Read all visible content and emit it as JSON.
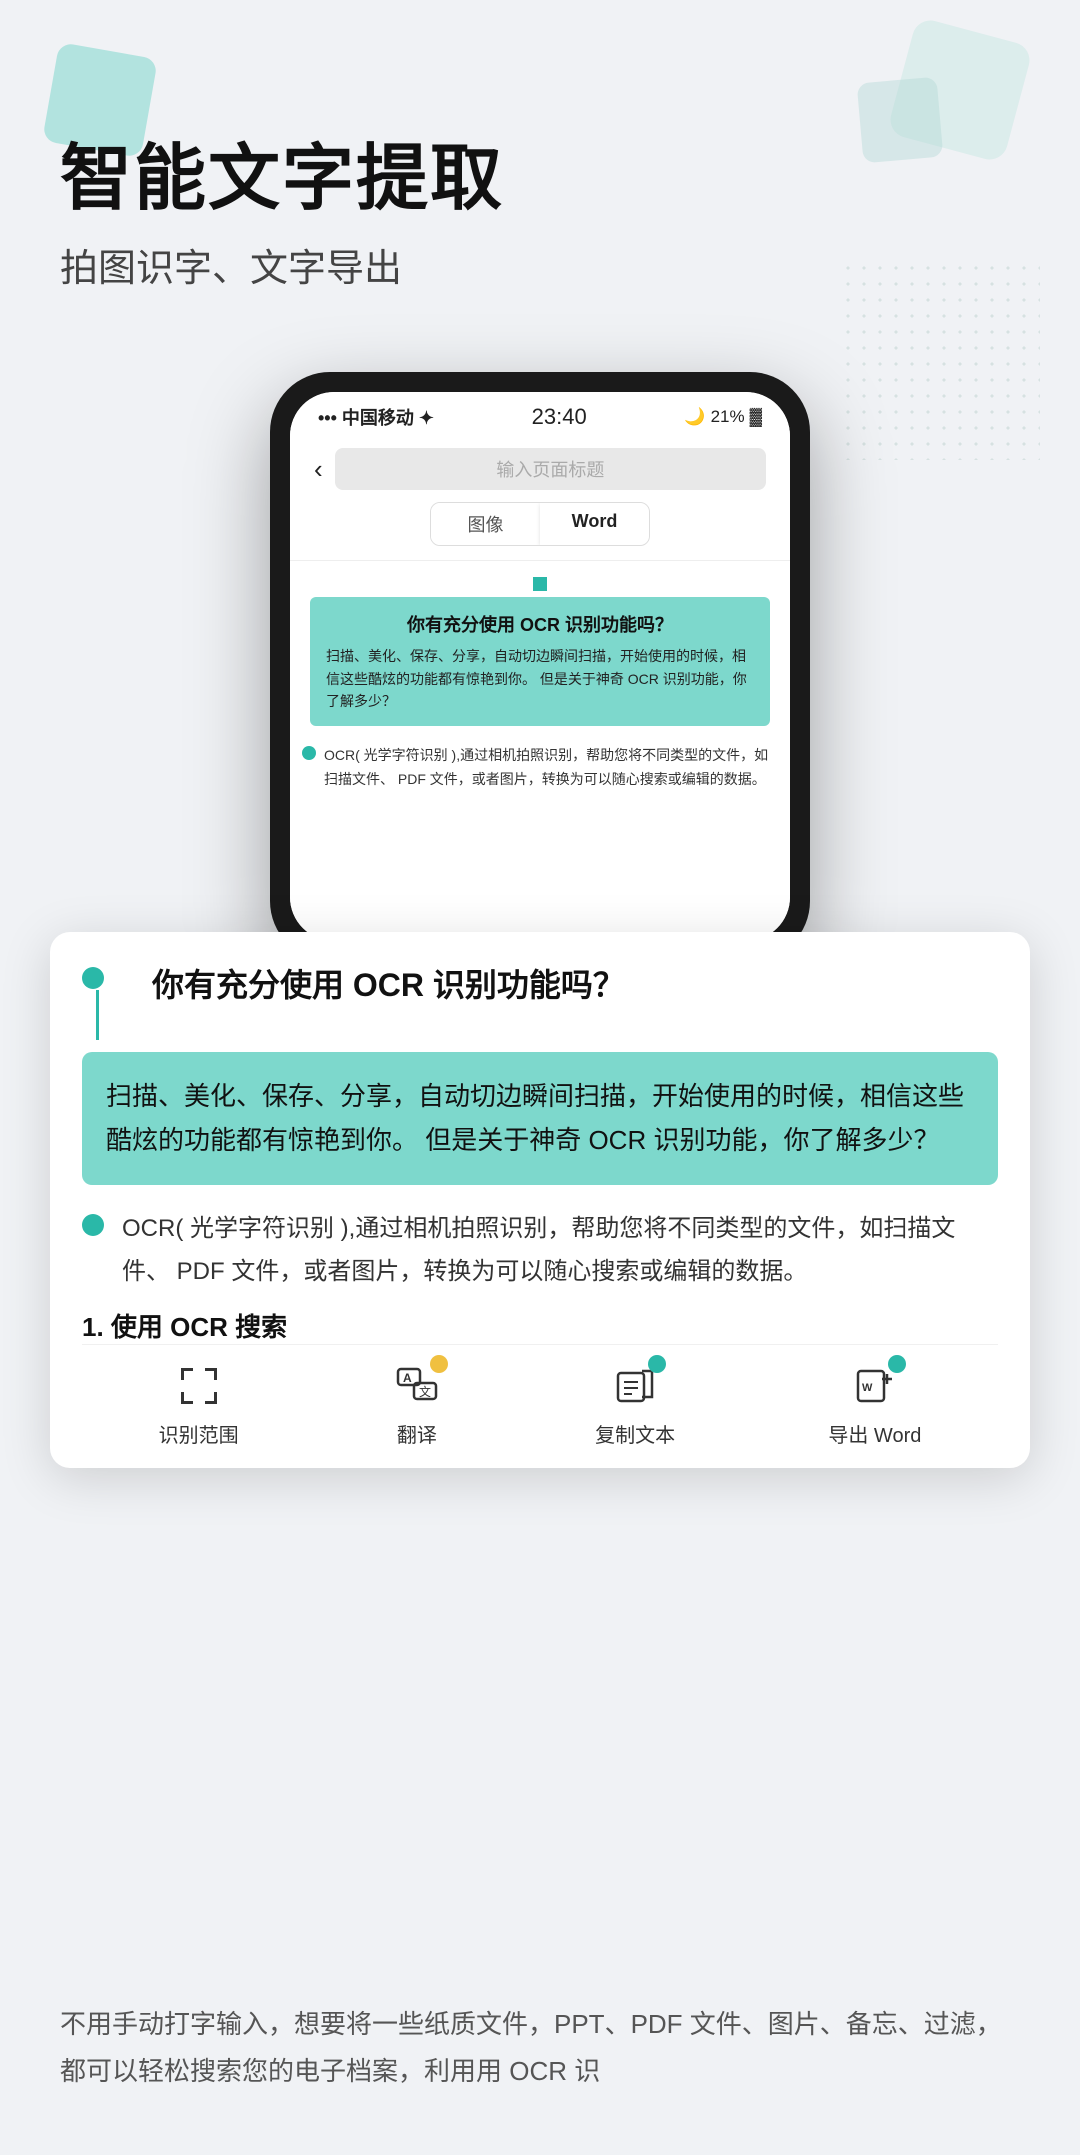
{
  "hero": {
    "title": "智能文字提取",
    "subtitle": "拍图识字、文字导出"
  },
  "phone": {
    "status": {
      "carrier": "中国移动 ✦",
      "time": "23:40",
      "battery": "21%"
    },
    "header": {
      "back": "‹",
      "title_placeholder": "输入页面标题",
      "tab_image": "图像",
      "tab_word": "Word"
    },
    "ocr": {
      "question": "你有充分使用 OCR 识别功能吗？",
      "paragraph1": "扫描、美化、保存、分享，自动切边瞬间扫描，开始使用的时候，相信这些酷炫的功能都有惊艳到你。 但是关于神奇 OCR 识别功能，你了解多少？",
      "paragraph2": "OCR( 光学字符识别 ),通过相机拍照识别，帮助您将不同类型的文件，如扫描文件、 PDF 文件，或者图片，转换为可以随心搜索或编辑的数据。"
    }
  },
  "expanded_panel": {
    "question": "你有充分使用 OCR 识别功能吗？",
    "paragraph1": "扫描、美化、保存、分享，自动切边瞬间扫描，开始使用的时候，相信这些酷炫的功能都有惊艳到你。 但是关于神奇 OCR 识别功能，你了解多少？",
    "paragraph2": "OCR( 光学字符识别 ),通过相机拍照识别，帮助您将不同类型的文件，如扫描文件、 PDF 文件，或者图片，转换为可以随心搜索或编辑的数据。",
    "list_item_1": "1. 使用 OCR 搜索"
  },
  "toolbar": {
    "scan_label": "识别范围",
    "translate_label": "翻译",
    "copy_label": "复制文本",
    "export_label": "导出 Word"
  },
  "bottom_text": "不用手动打字输入，想要将一些纸质文件，PPT、PDF 文件、图片、备忘、过滤，都可以轻松搜索您的电子档案，利用用 OCR 识"
}
